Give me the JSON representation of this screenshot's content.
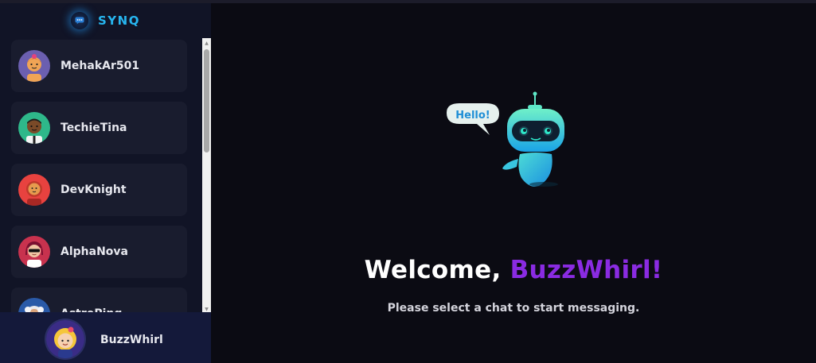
{
  "app": {
    "brand": "SYNQ"
  },
  "chats": [
    {
      "name": "MehakAr501"
    },
    {
      "name": "TechieTina"
    },
    {
      "name": "DevKnight"
    },
    {
      "name": "AlphaNova"
    },
    {
      "name": "AstroPing"
    }
  ],
  "current_user": {
    "name": "BuzzWhirl"
  },
  "welcome": {
    "greeting": "Welcome, ",
    "username": "BuzzWhirl",
    "exclaim": "!",
    "subtitle": "Please select a chat to start messaging."
  },
  "robot": {
    "bubble_text": "Hello!"
  },
  "colors": {
    "brand": "#27b6f0",
    "accent": "#8a2be2",
    "sidebar_bg": "#111426",
    "item_bg": "#191c2e",
    "main_bg": "#0b0b13"
  }
}
